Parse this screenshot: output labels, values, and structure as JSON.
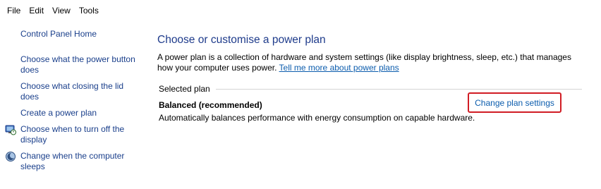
{
  "menubar": {
    "items": [
      {
        "label": "File"
      },
      {
        "label": "Edit"
      },
      {
        "label": "View"
      },
      {
        "label": "Tools"
      }
    ]
  },
  "sidebar": {
    "home_link": "Control Panel Home",
    "links": [
      {
        "label": "Choose what the power button does"
      },
      {
        "label": "Choose what closing the lid does"
      },
      {
        "label": "Create a power plan"
      },
      {
        "label": "Choose when to turn off the display",
        "icon": "display-power-icon"
      },
      {
        "label": "Change when the computer sleeps",
        "icon": "moon-sleep-icon"
      }
    ]
  },
  "main": {
    "title": "Choose or customise a power plan",
    "intro_text": "A power plan is a collection of hardware and system settings (like display brightness, sleep, etc.) that manages how your computer uses power. ",
    "intro_link": "Tell me more about power plans",
    "section_label": "Selected plan",
    "plan": {
      "name": "Balanced (recommended)",
      "description": "Automatically balances performance with energy consumption on capable hardware.",
      "change_link": "Change plan settings"
    }
  },
  "colors": {
    "link": "#1a3f8b",
    "title": "#1e3b8b",
    "highlight_border": "#d11c24"
  }
}
